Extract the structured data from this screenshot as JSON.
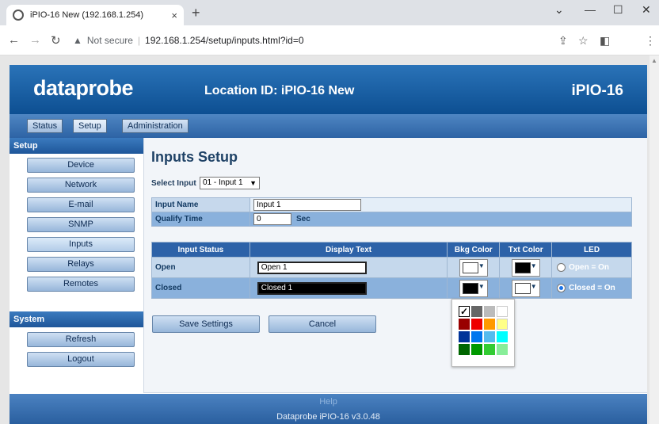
{
  "browser": {
    "tab_title": "iPIO-16 New (192.168.1.254)",
    "close_tab": "×",
    "new_tab": "+",
    "not_secure": "Not secure",
    "url": "192.168.1.254/setup/inputs.html?id=0",
    "win_min": "—",
    "win_max": "☐",
    "win_close": "✕",
    "chevron": "⌄"
  },
  "header": {
    "logo": "dataprobe",
    "location": "Location ID: iPIO-16 New",
    "model": "iPIO-16"
  },
  "menu": {
    "status": "Status",
    "setup": "Setup",
    "administration": "Administration"
  },
  "sidebar": {
    "setup_title": "Setup",
    "setup_items": [
      "Device",
      "Network",
      "E-mail",
      "SNMP",
      "Inputs",
      "Relays",
      "Remotes"
    ],
    "system_title": "System",
    "system_items": [
      "Refresh",
      "Logout"
    ]
  },
  "main": {
    "title": "Inputs Setup",
    "select_label": "Select Input",
    "select_value": "01 - Input 1",
    "input_name_label": "Input Name",
    "input_name_value": "Input 1",
    "qualify_label": "Qualify Time",
    "qualify_value": "0",
    "qualify_unit": "Sec",
    "headers": [
      "Input Status",
      "Display Text",
      "Bkg Color",
      "Txt Color",
      "LED"
    ],
    "rows": [
      {
        "status": "Open",
        "display": "Open 1",
        "bkg": "#ffffff",
        "txt": "#000000",
        "led": "Open = On",
        "led_selected": false
      },
      {
        "status": "Closed",
        "display": "Closed 1",
        "bkg": "#000000",
        "txt": "#ffffff",
        "led": "Closed = On",
        "led_selected": true
      }
    ],
    "save_label": "Save Settings",
    "cancel_label": "Cancel"
  },
  "palette": {
    "colors": [
      [
        "#000000",
        "#666666",
        "#bbbbbb",
        "#ffffff"
      ],
      [
        "#990000",
        "#ee0000",
        "#ff9900",
        "#ffff88"
      ],
      [
        "#003399",
        "#0077ee",
        "#55bbee",
        "#00ffff"
      ],
      [
        "#006600",
        "#009900",
        "#33cc33",
        "#88ee99"
      ]
    ],
    "selected": "#000000"
  },
  "footer": {
    "help": "Help",
    "version": "Dataprobe iPIO-16 v3.0.48"
  },
  "colors": {
    "header_blue": "#1a5fa3",
    "menu_blue": "#3e75b6",
    "content_bg": "#f2f5f9"
  }
}
